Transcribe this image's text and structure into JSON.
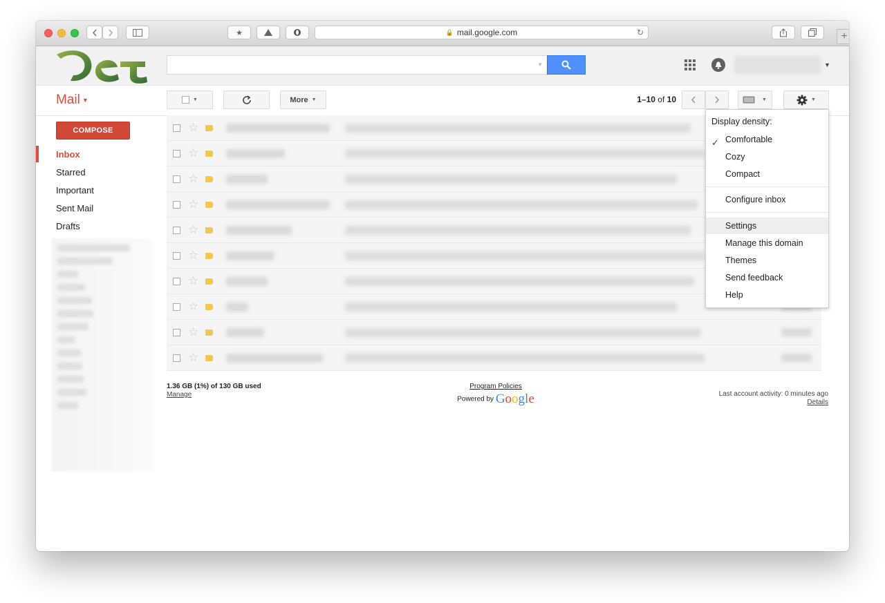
{
  "browser": {
    "url": "mail.google.com"
  },
  "header": {
    "search_placeholder": ""
  },
  "toolbar": {
    "mail_label": "Mail",
    "more_label": "More",
    "pager_range": "1–10",
    "pager_of": "of",
    "pager_total": "10"
  },
  "sidebar": {
    "compose_label": "COMPOSE",
    "items": [
      {
        "label": "Inbox"
      },
      {
        "label": "Starred"
      },
      {
        "label": "Important"
      },
      {
        "label": "Sent Mail"
      },
      {
        "label": "Drafts"
      }
    ]
  },
  "footer": {
    "storage": "1.36 GB (1%) of 130 GB used",
    "manage": "Manage",
    "program_policies": "Program Policies",
    "powered_by": "Powered by",
    "google": "Google",
    "last_activity": "Last account activity: 0 minutes ago",
    "details": "Details"
  },
  "settings_menu": {
    "density_header": "Display density:",
    "items": [
      {
        "label": "Comfortable"
      },
      {
        "label": "Cozy"
      },
      {
        "label": "Compact"
      },
      {
        "label": "Configure inbox"
      },
      {
        "label": "Settings"
      },
      {
        "label": "Manage this domain"
      },
      {
        "label": "Themes"
      },
      {
        "label": "Send feedback"
      },
      {
        "label": "Help"
      }
    ]
  },
  "colors": {
    "accent_red": "#dd4b39",
    "compose_red": "#d14836",
    "search_blue": "#4d90fe",
    "label_yellow": "#f4c74a"
  }
}
